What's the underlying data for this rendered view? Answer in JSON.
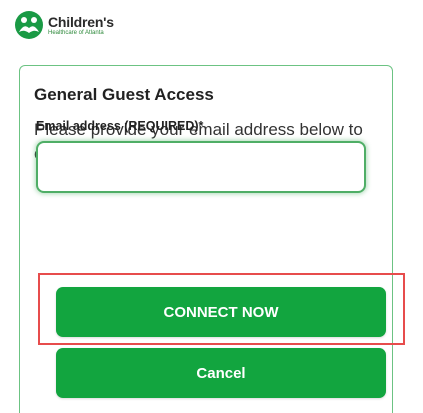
{
  "brand": {
    "name": "Children's",
    "subtitle": "Healthcare of Atlanta",
    "accent_color": "#12a53f"
  },
  "form": {
    "title": "General Guest Access",
    "description": "Please provide your email address below to continue.",
    "email_label": "Email address (REQUIRED)*",
    "email_value": "",
    "connect_label": "CONNECT NOW",
    "cancel_label": "Cancel"
  }
}
